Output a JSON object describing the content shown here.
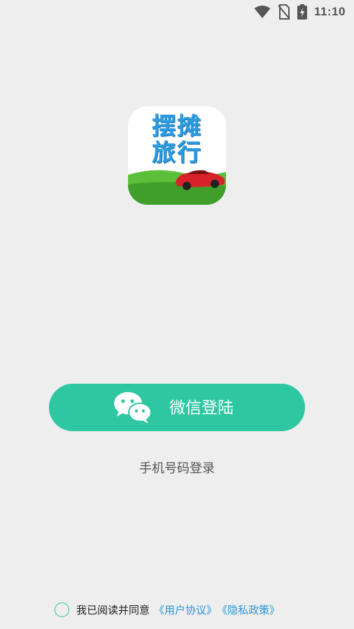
{
  "status_bar": {
    "time": "11:10",
    "icons": [
      "wifi-icon",
      "no-sim-icon",
      "battery-charging-icon"
    ]
  },
  "logo": {
    "line1": "摆摊",
    "line2": "旅行"
  },
  "wechat_login": {
    "label": "微信登陆",
    "icon": "wechat-icon"
  },
  "phone_login": {
    "label": "手机号码登录"
  },
  "agreement": {
    "text": "我已阅读并同意",
    "user_agreement": "《用户协议》",
    "privacy_policy": "《隐私政策》",
    "checked": false
  },
  "colors": {
    "background": "#eeeeee",
    "accent": "#2ec7a2",
    "link": "#2b96d8"
  }
}
